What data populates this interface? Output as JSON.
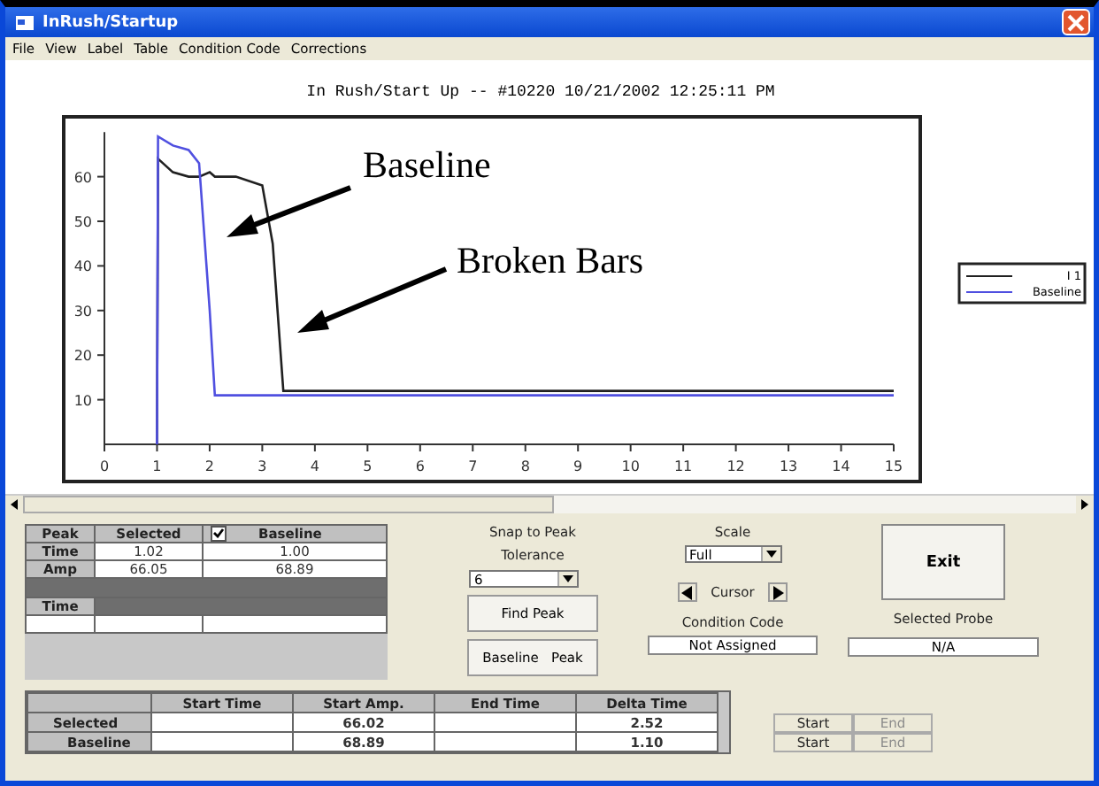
{
  "window": {
    "title": "InRush/Startup"
  },
  "menu": [
    "File",
    "View",
    "Label",
    "Table",
    "Condition Code",
    "Corrections"
  ],
  "chart": {
    "title": "In Rush/Start Up -- #10220 10/21/2002 12:25:11 PM",
    "chart_data": {
      "type": "line",
      "x": [
        1,
        1.02,
        1.3,
        1.6,
        1.8,
        2,
        2.1,
        2.5,
        3,
        3.2,
        3.4,
        4,
        5,
        6,
        7,
        8,
        9,
        10,
        11,
        12,
        13,
        14,
        15
      ],
      "series": [
        {
          "name": "I 1",
          "color": "#202020",
          "values": [
            0,
            64,
            61,
            60,
            60,
            61,
            60,
            60,
            58,
            45,
            12,
            12,
            12,
            12,
            12,
            12,
            12,
            12,
            12,
            12,
            12,
            12,
            12
          ]
        },
        {
          "name": "Baseline",
          "color": "#5050e0",
          "values": [
            0,
            69,
            67,
            66,
            63,
            30,
            11,
            11,
            11,
            11,
            11,
            11,
            11,
            11,
            11,
            11,
            11,
            11,
            11,
            11,
            11,
            11,
            11
          ]
        }
      ],
      "xlim": [
        0,
        15
      ],
      "ylim": [
        0,
        70
      ],
      "xticks": [
        0,
        1,
        2,
        3,
        4,
        5,
        6,
        7,
        8,
        9,
        10,
        11,
        12,
        13,
        14,
        15
      ],
      "yticks": [
        10,
        20,
        30,
        40,
        50,
        60
      ],
      "annotations": [
        "Baseline",
        "Broken Bars"
      ]
    }
  },
  "peak_table": {
    "columns": [
      "Peak",
      "Selected",
      "Baseline"
    ],
    "baseline_checked": true,
    "rows": [
      {
        "label": "Time",
        "selected": "1.02",
        "baseline": "1.00"
      },
      {
        "label": "Amp",
        "selected": "66.05",
        "baseline": "68.89"
      }
    ],
    "second_header": "Time"
  },
  "snap": {
    "label": "Snap to Peak",
    "tolerance_label": "Tolerance",
    "tolerance": "6",
    "find_button": "Find Peak",
    "baseline_peak_button": "Baseline   Peak"
  },
  "scale": {
    "label": "Scale",
    "value": "Full",
    "cursor_label": "Cursor"
  },
  "condition_code": {
    "label": "Condition Code",
    "value": "Not Assigned"
  },
  "exit_button": "Exit",
  "selected_probe": {
    "label": "Selected Probe",
    "value": "N/A"
  },
  "time_table": {
    "columns": [
      "Start Time",
      "Start Amp.",
      "End Time",
      "Delta Time"
    ],
    "rows": [
      {
        "label": "Selected",
        "start_amp": "66.02",
        "delta_time": "2.52"
      },
      {
        "label": "Baseline",
        "start_amp": "68.89",
        "delta_time": "1.10"
      }
    ]
  },
  "start_end": [
    [
      {
        "label": "Start",
        "disabled": false
      },
      {
        "label": "End",
        "disabled": true
      }
    ],
    [
      {
        "label": "Start",
        "disabled": false
      },
      {
        "label": "End",
        "disabled": true
      }
    ]
  ]
}
